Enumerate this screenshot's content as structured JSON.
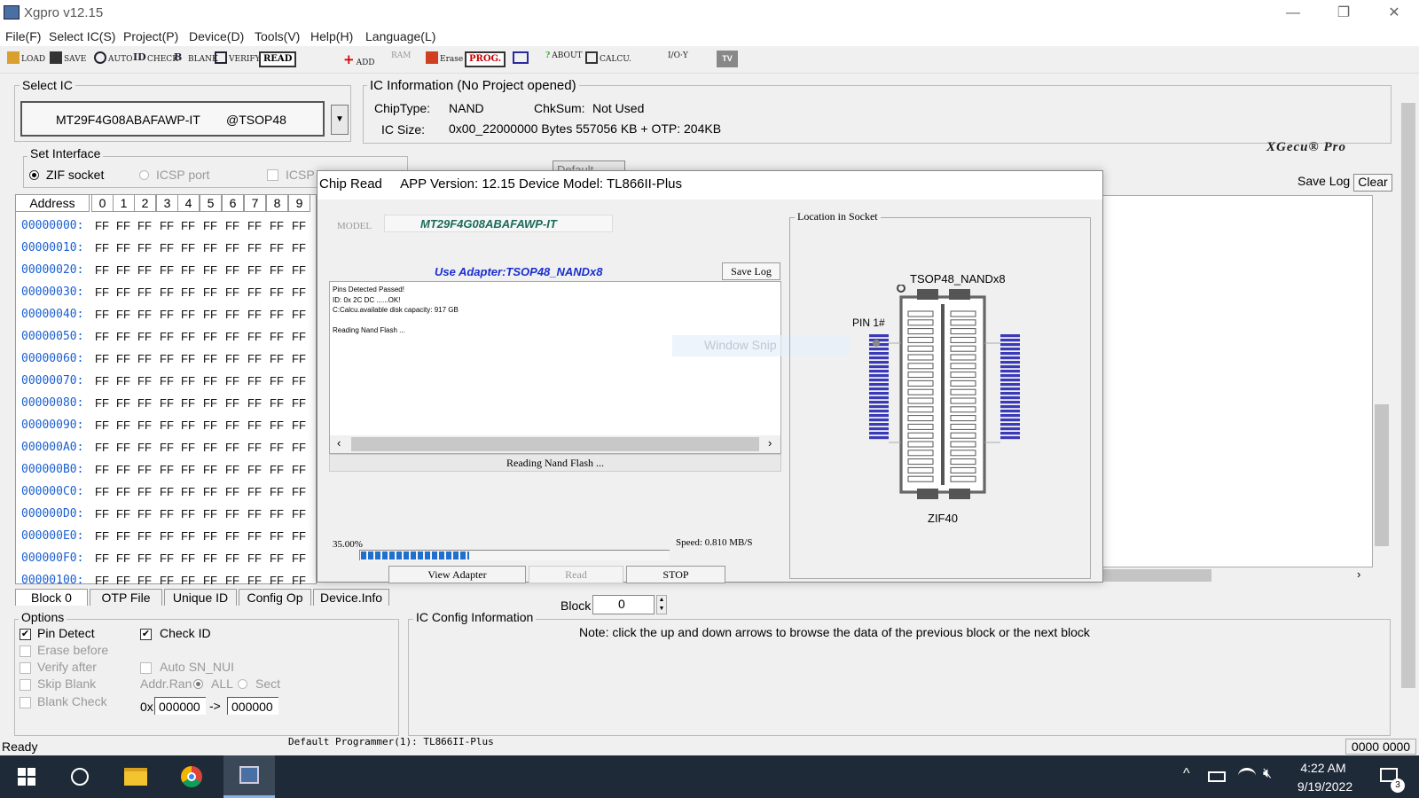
{
  "window": {
    "title": "Xgpro v12.15",
    "minimize": "—",
    "restore": "❐",
    "close": "✕"
  },
  "menu": [
    "File(F)",
    "Select IC(S)",
    "Project(P)",
    "Device(D)",
    "Tools(V)",
    "Help(H)",
    "Language(L)"
  ],
  "toolbar": {
    "load": "LOAD",
    "save": "SAVE",
    "auto": "AUTO",
    "check": "CHECK",
    "blank": "BLANK",
    "verify": "VERIFY",
    "read": "READ",
    "add": "ADD",
    "ram": "RAM",
    "erase": "Erase",
    "prog": "PROG.",
    "about": "ABOUT",
    "calcu": "CALCU.",
    "tv": "TV",
    "io": "I/O·Y"
  },
  "select_ic": {
    "legend": "Select IC",
    "chip": "MT29F4G08ABAFAWP-IT",
    "package": "@TSOP48"
  },
  "ic_info": {
    "legend": "IC Information (No Project opened)",
    "chip_type_label": "ChipType:",
    "chip_type": "NAND",
    "chksum_label": "ChkSum:",
    "chksum": "Not Used",
    "size_label": "IC Size:",
    "size": "0x00_22000000 Bytes 557056 KB  + OTP: 204KB",
    "brand": "XGecu® Pro"
  },
  "interface": {
    "legend": "Set Interface",
    "zif": "ZIF socket",
    "icsp_port": "ICSP port",
    "icsp": "ICSP",
    "default_select": "Default"
  },
  "log_buttons": {
    "save": "Save Log",
    "clear": "Clear"
  },
  "hex": {
    "address_label": "Address",
    "columns": [
      "0",
      "1",
      "2",
      "3",
      "4",
      "5",
      "6",
      "7",
      "8",
      "9"
    ],
    "rows": [
      "00000000:",
      "00000010:",
      "00000020:",
      "00000030:",
      "00000040:",
      "00000050:",
      "00000060:",
      "00000070:",
      "00000080:",
      "00000090:",
      "000000A0:",
      "000000B0:",
      "000000C0:",
      "000000D0:",
      "000000E0:",
      "000000F0:",
      "00000100:"
    ],
    "cell": "FF"
  },
  "tabs": [
    "Block 0",
    "OTP File",
    "Unique ID",
    "Config Op",
    "Device.Info"
  ],
  "block": {
    "label": "Block",
    "value": "0"
  },
  "options": {
    "legend": "Options",
    "pin_detect": "Pin Detect",
    "check_id": "Check ID",
    "erase_before": "Erase before",
    "verify_after": "Verify after",
    "auto_sn": "Auto SN_NUI",
    "skip_blank": "Skip Blank",
    "addr_range": "Addr.Ran",
    "all": "ALL",
    "sect": "Sect",
    "blank_check": "Blank Check",
    "ox": "0x",
    "from": "000000",
    "arrow": "->",
    "to": "000000"
  },
  "ic_config": {
    "legend": "IC Config Information",
    "note": "Note: click the up and down arrows to browse the data of the previous block or the next block"
  },
  "status": {
    "ready": "Ready",
    "programmer": "Default Programmer(1): TL866II-Plus",
    "counter": "0000 0000"
  },
  "dialog": {
    "title": "Chip Read",
    "app_version": "APP Version: 12.15 Device Model: TL866II-Plus",
    "model_label": "MODEL",
    "model": "MT29F4G08ABAFAWP-IT",
    "adapter": "Use Adapter:TSOP48_NANDx8",
    "save_log": "Save Log",
    "log_lines": [
      "Pins Detected Passed!",
      "ID: 0x 2C DC ......OK!",
      "C:Calcu.available disk capacity: 917 GB",
      "",
      "Reading Nand Flash ..."
    ],
    "status": "Reading Nand Flash ...",
    "progress_text": "35.00%",
    "progress": 0.35,
    "speed": "Speed: 0.810 MB/S",
    "btn_view": "View Adapter",
    "btn_read": "Read",
    "btn_stop": "STOP",
    "socket_legend": "Location in Socket",
    "adapter_name": "TSOP48_NANDx8",
    "pin1": "PIN 1#",
    "zif": "ZIF40",
    "ghost": "Window Snip"
  },
  "taskbar": {
    "time": "4:22 AM",
    "date": "9/19/2022",
    "notif": "3"
  }
}
